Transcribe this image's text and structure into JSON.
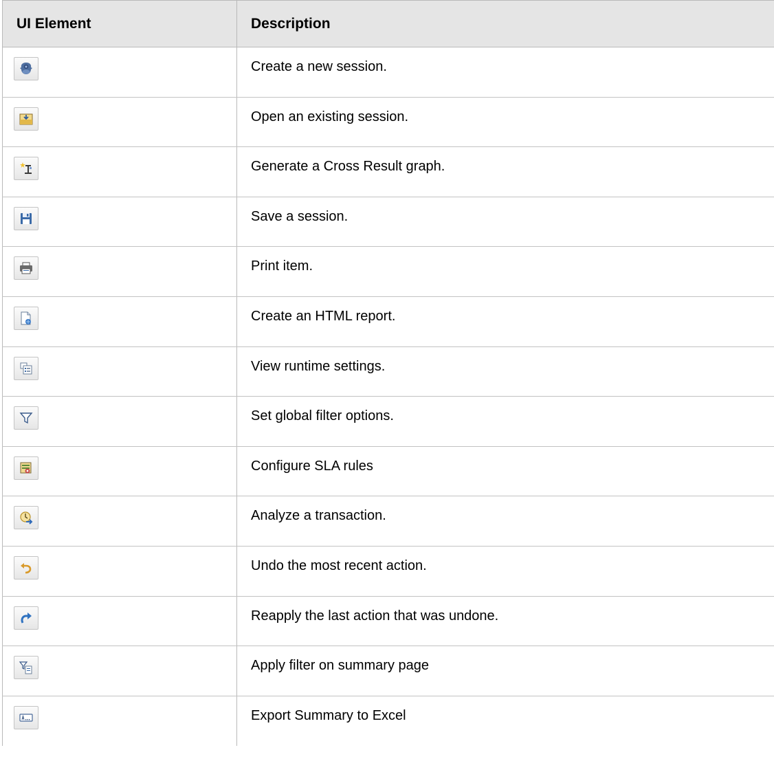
{
  "table": {
    "header": {
      "col1": "UI Element",
      "col2": "Description"
    },
    "rows": [
      {
        "icon": "new-session-icon",
        "description": "Create a new session."
      },
      {
        "icon": "open-session-icon",
        "description": "Open an existing session."
      },
      {
        "icon": "cross-result-graph-icon",
        "description": "Generate a Cross Result graph."
      },
      {
        "icon": "save-icon",
        "description": "Save a session."
      },
      {
        "icon": "print-icon",
        "description": "Print item."
      },
      {
        "icon": "html-report-icon",
        "description": "Create an HTML report."
      },
      {
        "icon": "runtime-settings-icon",
        "description": "View runtime settings."
      },
      {
        "icon": "filter-icon",
        "description": "Set global filter options."
      },
      {
        "icon": "sla-rules-icon",
        "description": "Configure SLA rules"
      },
      {
        "icon": "analyze-transaction-icon",
        "description": "Analyze a transaction."
      },
      {
        "icon": "undo-icon",
        "description": "Undo the most recent action."
      },
      {
        "icon": "redo-icon",
        "description": "Reapply the last action that was undone."
      },
      {
        "icon": "summary-filter-icon",
        "description": "Apply filter on summary page"
      },
      {
        "icon": "export-excel-icon",
        "description": "Export Summary to Excel"
      }
    ]
  },
  "colors": {
    "header_bg": "#e5e5e5",
    "grid_line": "#b9b9b9"
  }
}
